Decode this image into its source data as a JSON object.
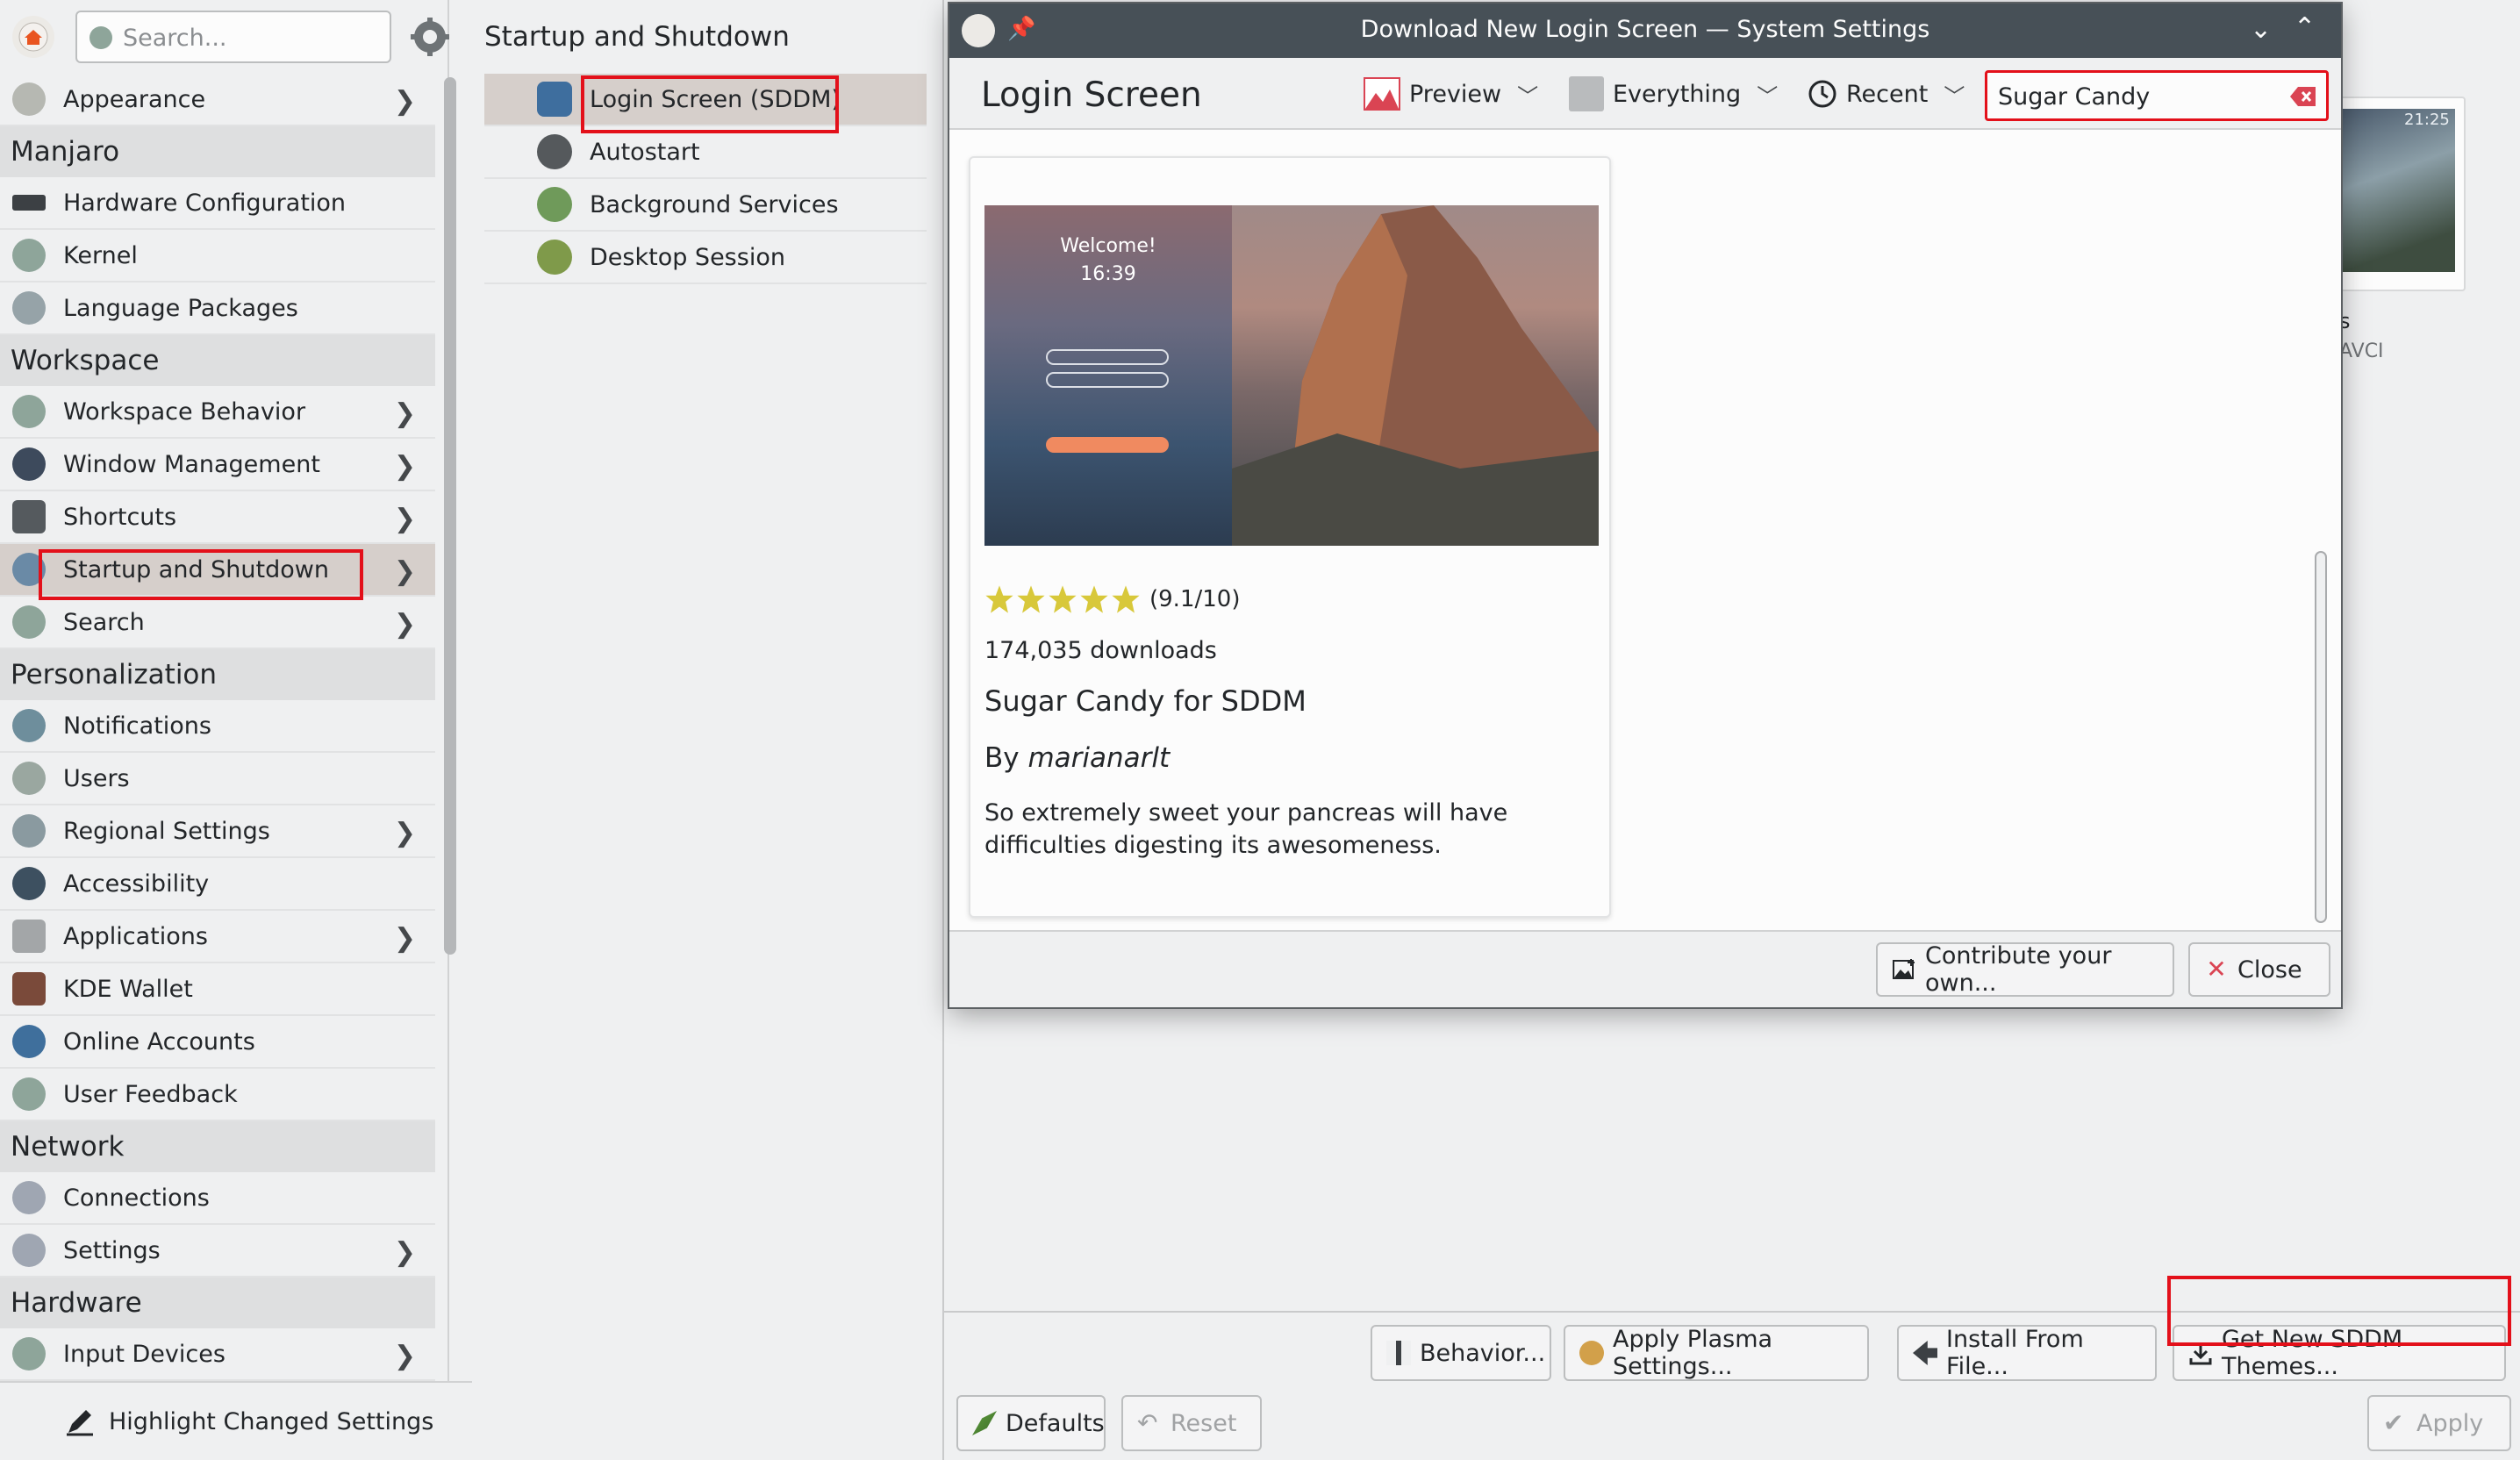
{
  "sidebar": {
    "search_placeholder": "Search...",
    "items": [
      {
        "label": "Appearance"
      },
      {
        "category": "Manjaro"
      },
      {
        "label": "Hardware Configuration"
      },
      {
        "label": "Kernel"
      },
      {
        "label": "Language Packages"
      },
      {
        "category": "Workspace"
      },
      {
        "label": "Workspace Behavior"
      },
      {
        "label": "Window Management"
      },
      {
        "label": "Shortcuts"
      },
      {
        "label": "Startup and Shutdown"
      },
      {
        "label": "Search"
      },
      {
        "category": "Personalization"
      },
      {
        "label": "Notifications"
      },
      {
        "label": "Users"
      },
      {
        "label": "Regional Settings"
      },
      {
        "label": "Accessibility"
      },
      {
        "label": "Applications"
      },
      {
        "label": "KDE Wallet"
      },
      {
        "label": "Online Accounts"
      },
      {
        "label": "User Feedback"
      },
      {
        "category": "Network"
      },
      {
        "label": "Connections"
      },
      {
        "label": "Settings"
      },
      {
        "category": "Hardware"
      },
      {
        "label": "Input Devices"
      }
    ],
    "highlight_label": "Highlight Changed Settings"
  },
  "middle": {
    "title": "Startup and Shutdown",
    "items": [
      {
        "label": "Login Screen (SDDM)"
      },
      {
        "label": "Autostart"
      },
      {
        "label": "Background Services"
      },
      {
        "label": "Desktop Session"
      }
    ]
  },
  "background_preview": {
    "time": "21:25",
    "title_fragment": "s",
    "author_fragment": "AVCI"
  },
  "bottom_buttons": {
    "behavior": "Behavior...",
    "apply_plasma": "Apply Plasma Settings...",
    "install_file": "Install From File...",
    "get_new": "Get New SDDM Themes...",
    "defaults": "Defaults",
    "reset": "Reset",
    "apply": "Apply"
  },
  "dialog": {
    "window_title": "Download New Login Screen — System Settings",
    "heading": "Login Screen",
    "view_mode": "Preview",
    "filter": "Everything",
    "sort": "Recent",
    "search_value": "Sugar Candy",
    "item": {
      "preview_welcome": "Welcome!",
      "preview_time": "16:39",
      "rating_text": "(9.1/10)",
      "rating_stars": 5,
      "downloads": "174,035 downloads",
      "title": "Sugar Candy for SDDM",
      "by": "By",
      "author": "marianarlt",
      "description": "So extremely sweet your pancreas will have difficulties digesting its awesomeness."
    },
    "contribute_label": "Contribute your own...",
    "close_label": "Close"
  }
}
